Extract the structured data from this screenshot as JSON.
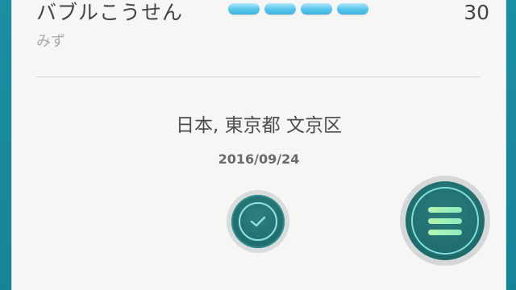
{
  "move": {
    "name": "バブルこうせん",
    "type": "みず",
    "power": "30",
    "energy_bars": 4,
    "energy_color": "#56c3ea"
  },
  "capture": {
    "location": "日本, 東京都 文京区",
    "date": "2016/09/24"
  },
  "controls": {
    "appraise_icon": "check-icon",
    "menu_icon": "hamburger-menu-icon"
  },
  "colors": {
    "frame": "#1a8a9e",
    "panel": "#f6f6f4",
    "button_teal": "#1f6e6f",
    "menu_lines": "#b4f5b1"
  }
}
